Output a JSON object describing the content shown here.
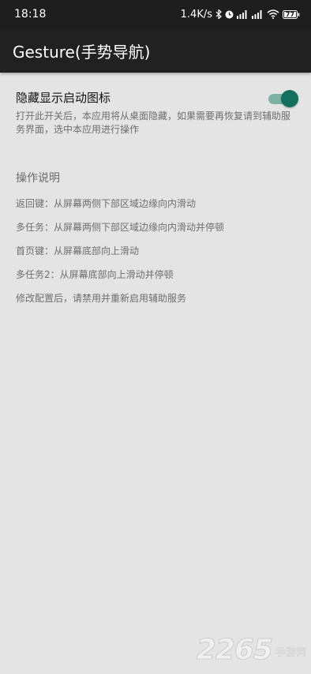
{
  "status_bar": {
    "time": "18:18",
    "network_speed": "1.4K/s",
    "battery": "77",
    "icons": [
      "bluetooth-icon",
      "alarm-icon",
      "signal-icon",
      "signal-icon",
      "wifi-icon",
      "battery-icon"
    ]
  },
  "app_bar": {
    "title": "Gesture(手势导航)"
  },
  "setting": {
    "title": "隐藏显示启动图标",
    "description": "打开此开关后，本应用将从桌面隐藏，如果需要再恢复请到辅助服务界面，选中本应用进行操作",
    "toggle_on": true,
    "accent_color": "#12705f"
  },
  "instructions": {
    "title": "操作说明",
    "items": [
      "返回键：从屏幕两侧下部区域边缘向内滑动",
      "多任务：从屏幕两侧下部区域边缘向内滑动并停顿",
      "首页键：从屏幕底部向上滑动",
      "多任务2：从屏幕底部向上滑动并停顿",
      "修改配置后，请禁用并重新启用辅助服务"
    ]
  },
  "watermark": {
    "number": "2265",
    "suffix": "手游网"
  }
}
